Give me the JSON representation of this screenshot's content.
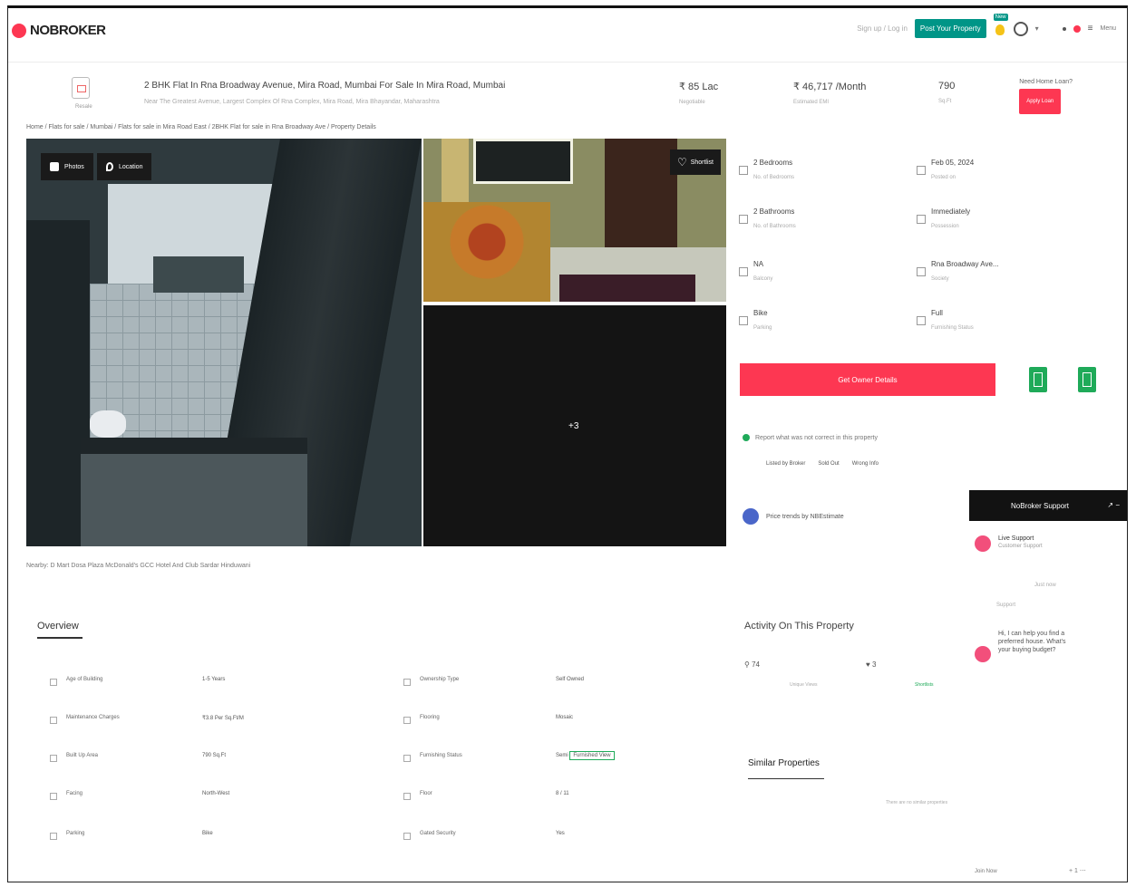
{
  "topbar": {
    "logo": "NOBROKER",
    "login_link": "Sign up / Log in",
    "post_property_label": "Post Your Property",
    "new_badge": "New",
    "menu_label": "Menu"
  },
  "property": {
    "icon_label": "Resale",
    "title": "2 BHK Flat In Rna Broadway Avenue, Mira Road, Mumbai For Sale In Mira Road, Mumbai",
    "subtitle": "Near The Greatest Avenue, Largest Complex Of Rna Complex, Mira Road, Mira Bhayandar, Maharashtra",
    "price": "₹ 85 Lac",
    "price_label": "Negotiable",
    "emi": "₹ 46,717 /Month",
    "emi_label": "Estimated EMI",
    "area": "790",
    "area_label": "Sq.Ft",
    "loan_title": "Need Home Loan?",
    "loan_button": "Apply Loan"
  },
  "breadcrumb": "Home / Flats for sale / Mumbai / Flats for sale in Mira Road East / 2BHK Flat for sale in Rna Broadway Ave / Property Details",
  "gallery": {
    "photos_tab": "Photos",
    "location_tab": "Location",
    "shortlist_label": "Shortlist",
    "more_count": "+3"
  },
  "nearby": "Nearby: D Mart  Dosa Plaza  McDonald's  GCC Hotel And Club  Sardar Hinduwani",
  "details": [
    {
      "value": "2 Bedrooms",
      "label": "No. of Bedrooms"
    },
    {
      "value": "Feb 05, 2024",
      "label": "Posted on"
    },
    {
      "value": "2 Bathrooms",
      "label": "No. of Bathrooms"
    },
    {
      "value": "Immediately",
      "label": "Possession"
    },
    {
      "value": "NA",
      "label": "Balcony"
    },
    {
      "value": "Rna Broadway Ave...",
      "label": "Society"
    },
    {
      "value": "Bike",
      "label": "Parking"
    },
    {
      "value": "Full",
      "label": "Furnishing Status"
    }
  ],
  "cta": {
    "get_owner_details": "Get Owner Details"
  },
  "report": {
    "text": "Report what was not correct in this property",
    "options": [
      "Listed by Broker",
      "Sold Out",
      "Wrong Info"
    ]
  },
  "price_trends": "Price trends by NBEstimate",
  "support": {
    "header": "NoBroker Support",
    "controls": "↗  −",
    "agent_name": "Live Support",
    "agent_sub": "Customer Support",
    "time_1": "Just now",
    "agent_label": "Support",
    "message": "Hi, I can help you find a preferred house. What's your buying budget?"
  },
  "overview": {
    "title": "Overview",
    "left": [
      {
        "label": "Age of Building",
        "value": "1-5 Years"
      },
      {
        "label": "Maintenance Charges",
        "value": "₹3.8 Per Sq.Ft/M"
      },
      {
        "label": "Built Up Area",
        "value": "790 Sq.Ft"
      },
      {
        "label": "Facing",
        "value": "North-West"
      },
      {
        "label": "Parking",
        "value": "Bike"
      }
    ],
    "right": [
      {
        "label": "Ownership Type",
        "value": "Self Owned"
      },
      {
        "label": "Flooring",
        "value": "Mosaic"
      },
      {
        "label": "Furnishing Status",
        "value": "Semi",
        "chip": "Furnished View"
      },
      {
        "label": "Floor",
        "value": "8 / 11"
      },
      {
        "label": "Gated Security",
        "value": "Yes"
      }
    ]
  },
  "activity": {
    "title": "Activity On This Property",
    "views": "74",
    "views_label": "Unique Views",
    "shortlists": "3",
    "shortlists_label": "Shortlists"
  },
  "similar": {
    "title": "Similar Properties",
    "empty": "There are no similar properties"
  },
  "footer": {
    "left": "Join Now",
    "right": "+  1  ⋯"
  }
}
